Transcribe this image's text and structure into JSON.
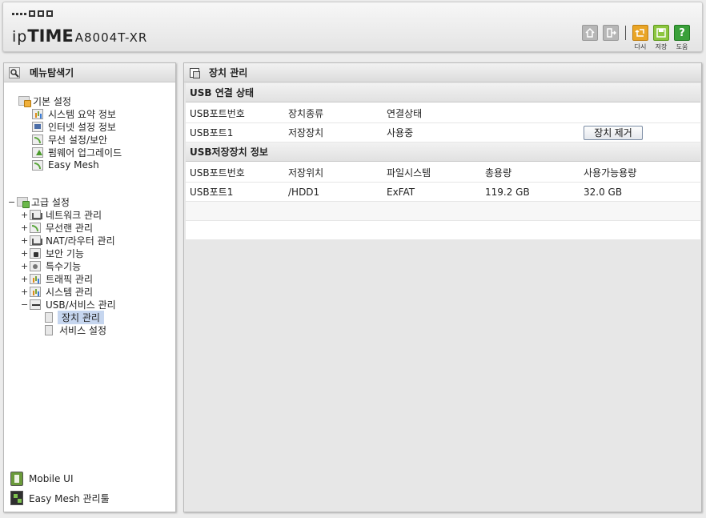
{
  "header": {
    "brand_ip": "ip",
    "brand_time": "TIME",
    "model": "A8004T-XR",
    "buttons": {
      "redo": "다시",
      "save": "저장",
      "help": "도움"
    },
    "help_glyph": "?",
    "icons": [
      "home-icon",
      "logout-icon",
      "redo-icon",
      "save-icon",
      "help-icon"
    ]
  },
  "left_panel": {
    "title": "메뉴탐색기",
    "basic": {
      "label": "기본 설정",
      "items": [
        "시스템 요약 정보",
        "인터넷 설정 정보",
        "무선 설정/보안",
        "펌웨어 업그레이드",
        "Easy Mesh"
      ]
    },
    "advanced": {
      "toggle": "−",
      "label": "고급 설정",
      "items": [
        {
          "toggle": "+",
          "label": "네트워크 관리"
        },
        {
          "toggle": "+",
          "label": "무선랜 관리"
        },
        {
          "toggle": "+",
          "label": "NAT/라우터 관리"
        },
        {
          "toggle": "+",
          "label": "보안 기능"
        },
        {
          "toggle": "+",
          "label": "특수기능"
        },
        {
          "toggle": "+",
          "label": "트래픽 관리"
        },
        {
          "toggle": "+",
          "label": "시스템 관리"
        },
        {
          "toggle": "−",
          "label": "USB/서비스 관리"
        }
      ],
      "usb_children": [
        "장치 관리",
        "서비스 설정"
      ]
    },
    "bottom_links": [
      "Mobile UI",
      "Easy Mesh 관리툴"
    ]
  },
  "right_panel": {
    "title": "장치 관리",
    "usb_status": {
      "title": "USB 연결 상태",
      "headers": [
        "USB포트번호",
        "장치종류",
        "연결상태"
      ],
      "row": [
        "USB포트1",
        "저장장치",
        "사용중"
      ],
      "remove_button": "장치 제거"
    },
    "storage_info": {
      "title": "USB저장장치 정보",
      "headers": [
        "USB포트번호",
        "저장위치",
        "파일시스템",
        "총용량",
        "사용가능용량"
      ],
      "row": [
        "USB포트1",
        "/HDD1",
        "ExFAT",
        "119.2 GB",
        "32.0 GB"
      ]
    }
  }
}
